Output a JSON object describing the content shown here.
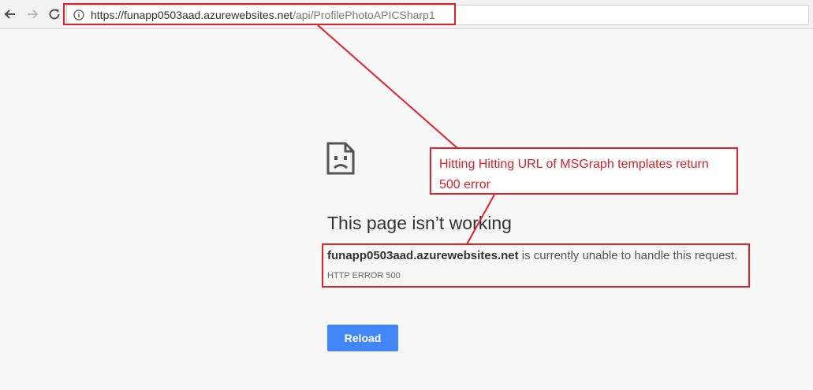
{
  "browser": {
    "url_host": "https://funapp0503aad.azurewebsites.net",
    "url_path": "/api/ProfilePhotoAPICSharp1"
  },
  "error_page": {
    "title": "This page isn’t working",
    "host": "funapp0503aad.azurewebsites.net",
    "message": " is currently unable to handle this request.",
    "error_code": "HTTP ERROR 500",
    "reload_label": "Reload"
  },
  "annotation": {
    "line1": "Hitting Hitting URL of MSGraph templates return",
    "line2": "500 error",
    "color": "#e0202a"
  },
  "colors": {
    "accent": "#4285f4",
    "annotation_red": "#e0202a"
  },
  "icons": [
    "back-arrow-icon",
    "forward-arrow-icon",
    "reload-icon",
    "info-icon",
    "sad-document-icon"
  ]
}
